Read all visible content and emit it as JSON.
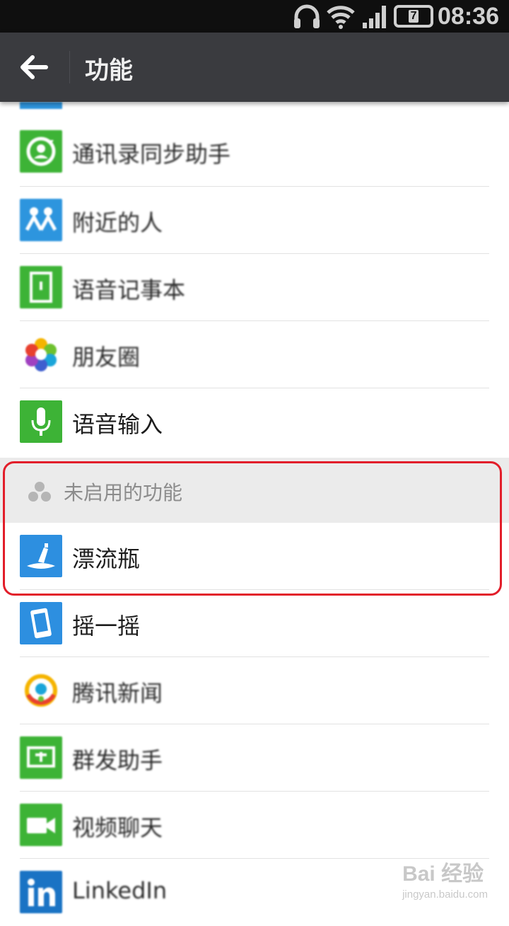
{
  "status_bar": {
    "time": "08:36",
    "battery_label": "7",
    "icons": [
      "headphones-icon",
      "wifi-icon",
      "signal-icon",
      "battery-icon"
    ]
  },
  "app_bar": {
    "title": "功能",
    "back_icon": "back-arrow-icon"
  },
  "enabled_features": [
    {
      "label": "通讯录同步助手",
      "icon": "contacts-sync-icon",
      "color": "#3db336"
    },
    {
      "label": "附近的人",
      "icon": "people-nearby-icon",
      "color": "#2d95de"
    },
    {
      "label": "语音记事本",
      "icon": "voice-notepad-icon",
      "color": "#3db336"
    },
    {
      "label": "朋友圈",
      "icon": "moments-icon",
      "color": "#ffffff"
    },
    {
      "label": "语音输入",
      "icon": "microphone-icon",
      "color": "#3db336"
    }
  ],
  "disabled_section": {
    "label": "未启用的功能",
    "icon": "disabled-features-icon"
  },
  "disabled_features": [
    {
      "label": "漂流瓶",
      "icon": "drift-bottle-icon",
      "color": "#2d8fe0"
    },
    {
      "label": "摇一摇",
      "icon": "shake-icon",
      "color": "#2d8fe0"
    },
    {
      "label": "腾讯新闻",
      "icon": "tencent-news-icon",
      "color": "#ffffff"
    },
    {
      "label": "群发助手",
      "icon": "broadcast-assistant-icon",
      "color": "#3db336"
    },
    {
      "label": "视频聊天",
      "icon": "video-chat-icon",
      "color": "#3db336"
    },
    {
      "label": "LinkedIn",
      "icon": "linkedin-icon",
      "color": "#1a73c4"
    }
  ],
  "watermark": {
    "main": "Bai 经验",
    "sub": "jingyan.baidu.com"
  },
  "colors": {
    "app_bar": "#3a3b3f",
    "highlight": "#e21e2a",
    "section_bg": "#ebebeb"
  }
}
